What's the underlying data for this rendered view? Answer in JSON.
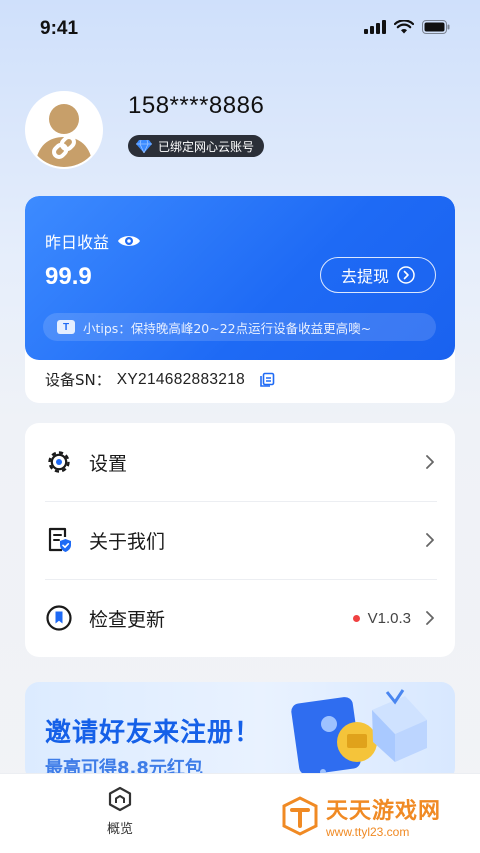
{
  "status_bar": {
    "time": "9:41"
  },
  "profile": {
    "phone": "158****8886",
    "badge_label": "已绑定网心云账号"
  },
  "earnings": {
    "label": "昨日收益",
    "value": "99.9",
    "withdraw_label": "去提现",
    "tips": "小tips：保持晚高峰20~22点运行设备收益更高噢~",
    "tips_icon_letter": "T",
    "sn_label": "设备SN：",
    "sn_value": "XY214682883218"
  },
  "menu": {
    "items": [
      {
        "label": "设置",
        "icon": "gear-icon"
      },
      {
        "label": "关于我们",
        "icon": "document-shield-icon"
      },
      {
        "label": "检查更新",
        "icon": "bookmark-circle-icon",
        "version": "V1.0.3"
      }
    ]
  },
  "invite": {
    "title": "邀请好友来注册！",
    "subtitle": "最高可得8.8元红包"
  },
  "tabbar": {
    "items": [
      {
        "label": "概览",
        "icon": "overview-icon"
      }
    ]
  },
  "watermark": {
    "title": "天天游戏网",
    "url": "www.ttyl23.com"
  },
  "colors": {
    "accent": "#1e6af5",
    "badge_bg": "#2b2f38",
    "dot_red": "#f04141",
    "watermark": "#f08a24"
  }
}
